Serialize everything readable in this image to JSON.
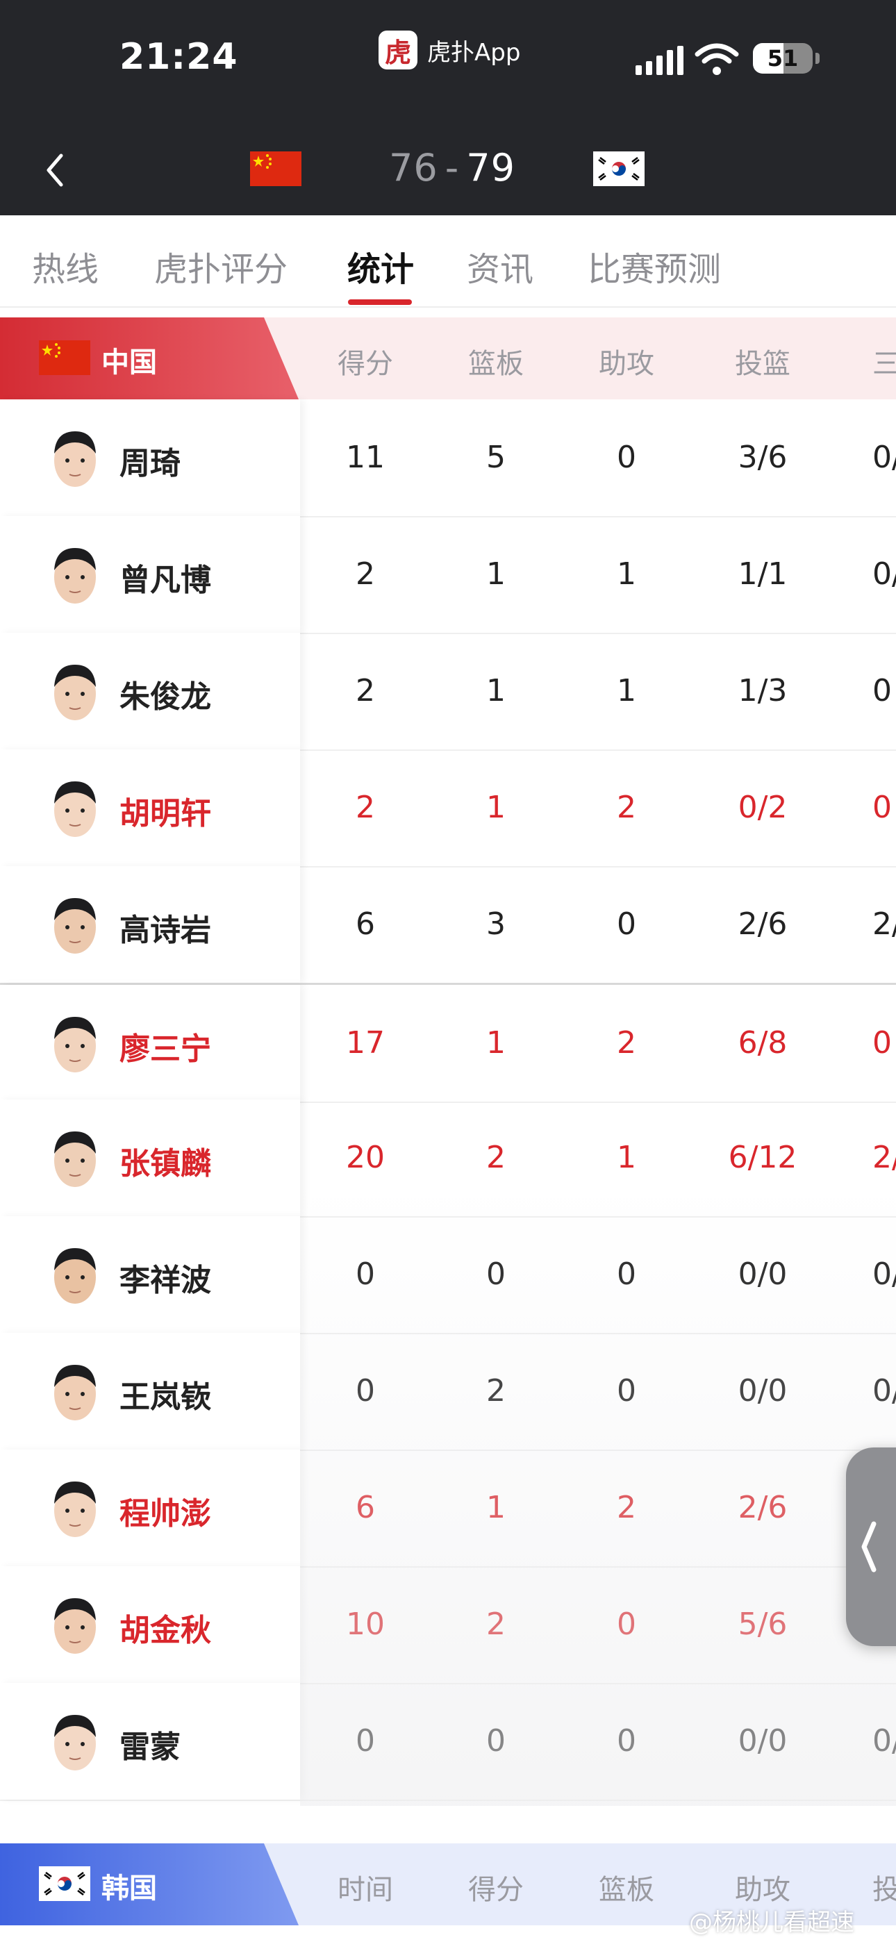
{
  "status_bar": {
    "time": "21:24",
    "app_name": "虎扑App",
    "app_logo_char": "虎",
    "battery": "51",
    "battery_level": 0.51
  },
  "match": {
    "home_score": "76",
    "separator": "-",
    "away_score": "79",
    "home_flag": "china-flag",
    "away_flag": "korea-flag"
  },
  "tabs": [
    {
      "label": "热线"
    },
    {
      "label": "虎扑评分"
    },
    {
      "label": "统计",
      "active": true
    },
    {
      "label": "资讯"
    },
    {
      "label": "比赛预测"
    }
  ],
  "china": {
    "team_name": "中国",
    "columns": [
      "得分",
      "篮板",
      "助攻",
      "投篮",
      "三"
    ],
    "players": [
      {
        "name": "周琦",
        "stats": [
          "11",
          "5",
          "0",
          "3/6",
          "0/"
        ],
        "highlight": false
      },
      {
        "name": "曾凡博",
        "stats": [
          "2",
          "1",
          "1",
          "1/1",
          "0/"
        ],
        "highlight": false
      },
      {
        "name": "朱俊龙",
        "stats": [
          "2",
          "1",
          "1",
          "1/3",
          "0"
        ],
        "highlight": false
      },
      {
        "name": "胡明轩",
        "stats": [
          "2",
          "1",
          "2",
          "0/2",
          "0"
        ],
        "highlight": true
      },
      {
        "name": "高诗岩",
        "stats": [
          "6",
          "3",
          "0",
          "2/6",
          "2/"
        ],
        "highlight": false
      },
      {
        "name": "廖三宁",
        "stats": [
          "17",
          "1",
          "2",
          "6/8",
          "0"
        ],
        "highlight": true
      },
      {
        "name": "张镇麟",
        "stats": [
          "20",
          "2",
          "1",
          "6/12",
          "2/"
        ],
        "highlight": true
      },
      {
        "name": "李祥波",
        "stats": [
          "0",
          "0",
          "0",
          "0/0",
          "0/"
        ],
        "highlight": false
      },
      {
        "name": "王岚嵚",
        "stats": [
          "0",
          "2",
          "0",
          "0/0",
          "0/"
        ],
        "highlight": false
      },
      {
        "name": "程帅澎",
        "stats": [
          "6",
          "1",
          "2",
          "2/6",
          ""
        ],
        "highlight": true
      },
      {
        "name": "胡金秋",
        "stats": [
          "10",
          "2",
          "0",
          "5/6",
          ""
        ],
        "highlight": true
      },
      {
        "name": "雷蒙",
        "stats": [
          "0",
          "0",
          "0",
          "0/0",
          "0/"
        ],
        "highlight": false
      }
    ]
  },
  "korea": {
    "team_name": "韩国",
    "columns": [
      "时间",
      "得分",
      "篮板",
      "助攻",
      "投"
    ]
  },
  "watermark": "@杨桃儿看超速",
  "colors": {
    "accent_red": "#d9262c",
    "header_dark": "#25262a",
    "korea_blue": "#3f63e0"
  }
}
